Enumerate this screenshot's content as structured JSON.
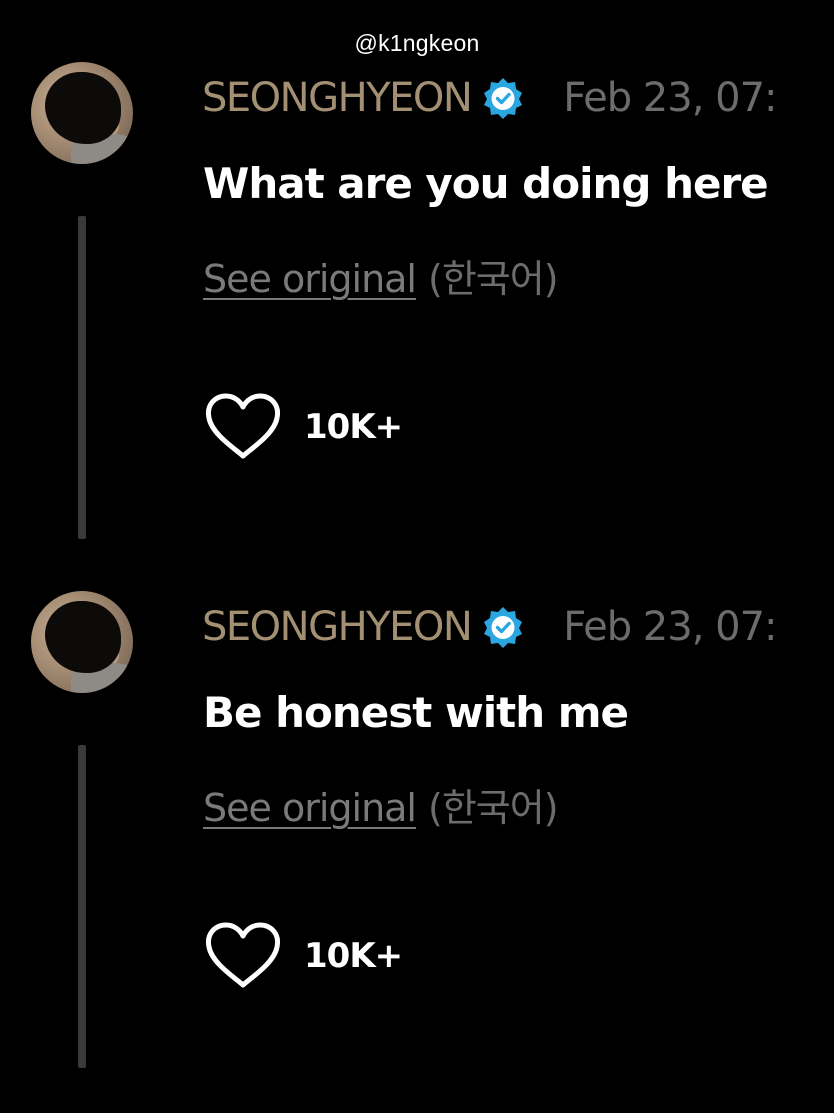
{
  "watermark": "@k1ngkeon",
  "accent": {
    "username_color": "#a39073",
    "verified_color": "#2aa6e0",
    "muted_color": "#6c6c6c"
  },
  "messages": [
    {
      "username": "SEONGHYEON",
      "verified_icon": "verified-badge-icon",
      "timestamp": "Feb 23, 07:",
      "text": "What are you doing here",
      "see_original": "See original",
      "language": "(한국어)",
      "like_icon": "heart-outline-icon",
      "like_count": "10K+"
    },
    {
      "username": "SEONGHYEON",
      "verified_icon": "verified-badge-icon",
      "timestamp": "Feb 23, 07:",
      "text": "Be honest with me",
      "see_original": "See original",
      "language": "(한국어)",
      "like_icon": "heart-outline-icon",
      "like_count": "10K+"
    }
  ]
}
